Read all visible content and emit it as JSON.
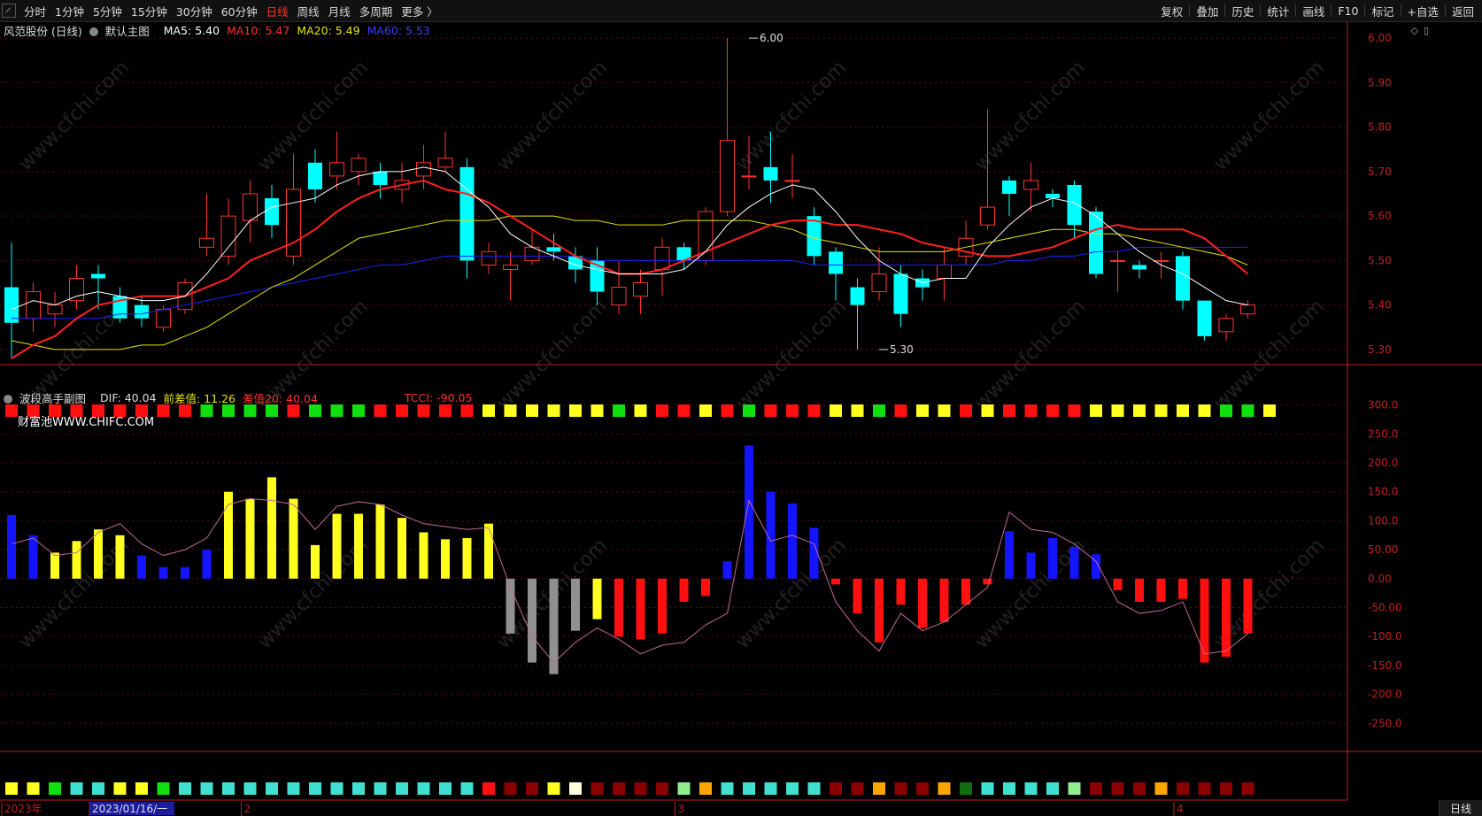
{
  "toolbar": {
    "periods": [
      {
        "label": "分时",
        "active": false
      },
      {
        "label": "1分钟",
        "active": false
      },
      {
        "label": "5分钟",
        "active": false
      },
      {
        "label": "15分钟",
        "active": false
      },
      {
        "label": "30分钟",
        "active": false
      },
      {
        "label": "60分钟",
        "active": false
      },
      {
        "label": "日线",
        "active": true
      },
      {
        "label": "周线",
        "active": false
      },
      {
        "label": "月线",
        "active": false
      },
      {
        "label": "多周期",
        "active": false
      },
      {
        "label": "更多 〉",
        "active": false
      }
    ],
    "right_items": [
      "复权",
      "叠加",
      "历史",
      "统计",
      "画线",
      "F10",
      "标记",
      "+自选",
      "返回"
    ]
  },
  "main_legend": {
    "stock": "风范股份 (日线)",
    "template": "默认主图",
    "ma5": "MA5: 5.40",
    "ma10": "MA10: 5.47",
    "ma20": "MA20: 5.49",
    "ma60": "MA60: 5.53"
  },
  "sub_legend": {
    "name": "波段高手副图",
    "dif": "DIF: 40.04",
    "prev_diff": "前差值: 11.26",
    "diff20": "差值20: 40.04",
    "tcci": "TCCI: -90.05"
  },
  "sub_watermark": "财富池WWW.CHIFC.COM",
  "watermark_text": "www.cfchi.com",
  "bottom_tag": "日线",
  "colors": {
    "up": "#ff3333",
    "down": "#00ffff",
    "ma5": "#ffffff",
    "ma10": "#ff2020",
    "ma20": "#e6e600",
    "ma60": "#2020ff",
    "axis": "#c02020",
    "grid": "#5a1010"
  },
  "chart_data": [
    {
      "type": "candlestick",
      "title": "风范股份 (日线)",
      "y_ticks": [
        "6.00",
        "5.90",
        "5.80",
        "5.70",
        "5.60",
        "5.50",
        "5.40",
        "5.30"
      ],
      "ylim": [
        5.27,
        6.03
      ],
      "annotations": [
        {
          "label": "6.00",
          "index": 34,
          "value": 6.0
        },
        {
          "label": "5.30",
          "index": 40,
          "value": 5.3
        }
      ],
      "x_labels": [
        {
          "label": "2023年",
          "index": 0
        },
        {
          "label": "2023/01/16/一",
          "index": 4
        },
        {
          "label": "2",
          "index": 11
        },
        {
          "label": "3",
          "index": 31
        },
        {
          "label": "4",
          "index": 54
        }
      ],
      "candles": [
        [
          5.44,
          5.36,
          5.54,
          5.28
        ],
        [
          5.37,
          5.43,
          5.45,
          5.34
        ],
        [
          5.38,
          5.4,
          5.43,
          5.35
        ],
        [
          5.41,
          5.46,
          5.49,
          5.39
        ],
        [
          5.47,
          5.46,
          5.49,
          5.39
        ],
        [
          5.42,
          5.37,
          5.44,
          5.36
        ],
        [
          5.4,
          5.37,
          5.42,
          5.35
        ],
        [
          5.35,
          5.39,
          5.4,
          5.34
        ],
        [
          5.39,
          5.45,
          5.46,
          5.38
        ],
        [
          5.53,
          5.55,
          5.65,
          5.51
        ],
        [
          5.51,
          5.6,
          5.64,
          5.49
        ],
        [
          5.59,
          5.65,
          5.68,
          5.54
        ],
        [
          5.64,
          5.58,
          5.67,
          5.55
        ],
        [
          5.51,
          5.66,
          5.74,
          5.49
        ],
        [
          5.72,
          5.66,
          5.75,
          5.63
        ],
        [
          5.69,
          5.72,
          5.79,
          5.66
        ],
        [
          5.7,
          5.73,
          5.74,
          5.67
        ],
        [
          5.7,
          5.67,
          5.72,
          5.64
        ],
        [
          5.66,
          5.68,
          5.72,
          5.63
        ],
        [
          5.69,
          5.72,
          5.76,
          5.66
        ],
        [
          5.71,
          5.73,
          5.79,
          5.7
        ],
        [
          5.71,
          5.5,
          5.73,
          5.46
        ],
        [
          5.49,
          5.52,
          5.54,
          5.47
        ],
        [
          5.48,
          5.49,
          5.52,
          5.41
        ],
        [
          5.5,
          5.53,
          5.57,
          5.49
        ],
        [
          5.53,
          5.52,
          5.56,
          5.5
        ],
        [
          5.51,
          5.48,
          5.53,
          5.45
        ],
        [
          5.5,
          5.43,
          5.53,
          5.4
        ],
        [
          5.4,
          5.44,
          5.5,
          5.38
        ],
        [
          5.42,
          5.45,
          5.48,
          5.38
        ],
        [
          5.48,
          5.53,
          5.55,
          5.42
        ],
        [
          5.53,
          5.5,
          5.54,
          5.48
        ],
        [
          5.5,
          5.61,
          5.62,
          5.49
        ],
        [
          5.61,
          5.77,
          6.0,
          5.6
        ],
        [
          5.69,
          5.69,
          5.78,
          5.66
        ],
        [
          5.71,
          5.68,
          5.79,
          5.63
        ],
        [
          5.68,
          5.68,
          5.74,
          5.64
        ],
        [
          5.6,
          5.51,
          5.62,
          5.49
        ],
        [
          5.52,
          5.47,
          5.53,
          5.41
        ],
        [
          5.44,
          5.4,
          5.46,
          5.3
        ],
        [
          5.43,
          5.47,
          5.53,
          5.41
        ],
        [
          5.47,
          5.38,
          5.49,
          5.35
        ],
        [
          5.46,
          5.44,
          5.48,
          5.41
        ],
        [
          5.46,
          5.49,
          5.53,
          5.41
        ],
        [
          5.51,
          5.55,
          5.59,
          5.49
        ],
        [
          5.58,
          5.62,
          5.84,
          5.57
        ],
        [
          5.68,
          5.65,
          5.69,
          5.6
        ],
        [
          5.66,
          5.68,
          5.72,
          5.61
        ],
        [
          5.65,
          5.64,
          5.66,
          5.62
        ],
        [
          5.67,
          5.58,
          5.68,
          5.55
        ],
        [
          5.61,
          5.47,
          5.62,
          5.46
        ],
        [
          5.5,
          5.5,
          5.52,
          5.43
        ],
        [
          5.49,
          5.48,
          5.5,
          5.46
        ],
        [
          5.5,
          5.5,
          5.52,
          5.46
        ],
        [
          5.51,
          5.41,
          5.52,
          5.39
        ],
        [
          5.41,
          5.33,
          5.41,
          5.32
        ],
        [
          5.34,
          5.37,
          5.38,
          5.32
        ],
        [
          5.38,
          5.4,
          5.41,
          5.37
        ]
      ],
      "ma5": [
        5.39,
        5.41,
        5.4,
        5.42,
        5.43,
        5.42,
        5.41,
        5.41,
        5.42,
        5.47,
        5.53,
        5.59,
        5.62,
        5.63,
        5.64,
        5.67,
        5.69,
        5.7,
        5.7,
        5.71,
        5.7,
        5.66,
        5.62,
        5.56,
        5.53,
        5.51,
        5.49,
        5.48,
        5.47,
        5.47,
        5.47,
        5.48,
        5.52,
        5.58,
        5.62,
        5.65,
        5.67,
        5.66,
        5.61,
        5.55,
        5.5,
        5.47,
        5.45,
        5.46,
        5.46,
        5.53,
        5.58,
        5.62,
        5.64,
        5.63,
        5.6,
        5.56,
        5.52,
        5.49,
        5.47,
        5.44,
        5.41,
        5.4
      ],
      "ma10": [
        5.28,
        5.31,
        5.33,
        5.37,
        5.4,
        5.41,
        5.42,
        5.42,
        5.42,
        5.44,
        5.46,
        5.5,
        5.52,
        5.54,
        5.57,
        5.61,
        5.64,
        5.66,
        5.67,
        5.68,
        5.66,
        5.65,
        5.63,
        5.6,
        5.57,
        5.54,
        5.51,
        5.49,
        5.47,
        5.47,
        5.48,
        5.5,
        5.52,
        5.54,
        5.56,
        5.58,
        5.59,
        5.59,
        5.58,
        5.58,
        5.57,
        5.56,
        5.54,
        5.53,
        5.52,
        5.51,
        5.51,
        5.52,
        5.53,
        5.55,
        5.57,
        5.58,
        5.57,
        5.57,
        5.57,
        5.55,
        5.51,
        5.47
      ],
      "ma20": [
        5.32,
        5.31,
        5.3,
        5.3,
        5.3,
        5.3,
        5.31,
        5.31,
        5.33,
        5.35,
        5.38,
        5.41,
        5.44,
        5.46,
        5.49,
        5.52,
        5.55,
        5.56,
        5.57,
        5.58,
        5.59,
        5.59,
        5.59,
        5.6,
        5.6,
        5.6,
        5.59,
        5.59,
        5.58,
        5.58,
        5.58,
        5.59,
        5.59,
        5.59,
        5.59,
        5.58,
        5.57,
        5.55,
        5.54,
        5.53,
        5.52,
        5.52,
        5.52,
        5.52,
        5.53,
        5.54,
        5.55,
        5.56,
        5.57,
        5.57,
        5.56,
        5.56,
        5.55,
        5.54,
        5.53,
        5.52,
        5.51,
        5.49
      ],
      "ma60": [
        5.37,
        5.37,
        5.37,
        5.37,
        5.37,
        5.38,
        5.38,
        5.39,
        5.4,
        5.41,
        5.42,
        5.43,
        5.44,
        5.45,
        5.46,
        5.47,
        5.48,
        5.49,
        5.49,
        5.5,
        5.51,
        5.51,
        5.51,
        5.51,
        5.51,
        5.51,
        5.51,
        5.5,
        5.5,
        5.5,
        5.5,
        5.5,
        5.5,
        5.5,
        5.5,
        5.5,
        5.5,
        5.49,
        5.49,
        5.49,
        5.49,
        5.49,
        5.49,
        5.49,
        5.49,
        5.49,
        5.5,
        5.5,
        5.51,
        5.51,
        5.52,
        5.52,
        5.53,
        5.53,
        5.53,
        5.53,
        5.53,
        5.53
      ]
    },
    {
      "type": "bar",
      "title": "波段高手副图",
      "y_ticks": [
        "300.0",
        "250.0",
        "200.0",
        "150.0",
        "100.0",
        "50.00",
        "0.00",
        "-50.00",
        "-100.0",
        "-150.0",
        "-200.0",
        "-250.0"
      ],
      "ylim": [
        -300,
        330
      ],
      "bars": [
        110,
        75,
        45,
        65,
        85,
        75,
        40,
        20,
        20,
        50,
        150,
        138,
        175,
        138,
        58,
        112,
        112,
        128,
        105,
        80,
        68,
        70,
        95,
        -95,
        -145,
        -165,
        -90,
        -70,
        -100,
        -105,
        -95,
        -40,
        -30,
        30,
        230,
        150,
        130,
        88,
        -10,
        -60,
        -110,
        -45,
        -85,
        -75,
        -45,
        -10,
        82,
        45,
        70,
        55,
        42,
        -20,
        -40,
        -40,
        -35,
        -145,
        -135,
        -95
      ],
      "bar_colors": [
        "blue",
        "blue",
        "yellow",
        "yellow",
        "yellow",
        "yellow",
        "blue",
        "blue",
        "blue",
        "blue",
        "yellow",
        "yellow",
        "yellow",
        "yellow",
        "yellow",
        "yellow",
        "yellow",
        "yellow",
        "yellow",
        "yellow",
        "yellow",
        "yellow",
        "yellow",
        "gray",
        "gray",
        "gray",
        "gray",
        "yellow",
        "red",
        "red",
        "red",
        "red",
        "red",
        "blue",
        "blue",
        "blue",
        "blue",
        "blue",
        "red",
        "red",
        "red",
        "red",
        "red",
        "red",
        "red",
        "red",
        "blue",
        "blue",
        "blue",
        "blue",
        "blue",
        "red",
        "red",
        "red",
        "red",
        "red",
        "red",
        "red"
      ],
      "line": [
        60,
        70,
        40,
        45,
        80,
        95,
        60,
        40,
        50,
        70,
        128,
        138,
        135,
        128,
        85,
        125,
        133,
        128,
        110,
        95,
        90,
        85,
        88,
        -15,
        -100,
        -145,
        -110,
        -85,
        -105,
        -130,
        -115,
        -110,
        -80,
        -60,
        135,
        65,
        75,
        60,
        -40,
        -90,
        -125,
        -60,
        -90,
        -75,
        -45,
        -15,
        115,
        85,
        80,
        60,
        30,
        -40,
        -60,
        -55,
        -40,
        -130,
        -125,
        -95
      ],
      "top_markers": [
        "red",
        "red",
        "red",
        "red",
        "red",
        "red",
        "red",
        "red",
        "red",
        "green",
        "green",
        "green",
        "green",
        "red",
        "green",
        "green",
        "green",
        "red",
        "red",
        "red",
        "red",
        "red",
        "yellow",
        "yellow",
        "yellow",
        "yellow",
        "yellow",
        "yellow",
        "green",
        "yellow",
        "red",
        "red",
        "yellow",
        "red",
        "green",
        "red",
        "red",
        "red",
        "yellow",
        "yellow",
        "green",
        "red",
        "yellow",
        "yellow",
        "red",
        "yellow",
        "red",
        "red",
        "red",
        "red",
        "yellow",
        "yellow",
        "yellow",
        "yellow",
        "yellow",
        "yellow",
        "green",
        "green",
        "yellow"
      ],
      "bottom_markers": [
        "yellow",
        "yellow",
        "green",
        "cyan",
        "cyan",
        "yellow",
        "yellow",
        "green",
        "cyan",
        "cyan",
        "cyan",
        "cyan",
        "cyan",
        "cyan",
        "cyan",
        "cyan",
        "cyan",
        "cyan",
        "cyan",
        "cyan",
        "cyan",
        "cyan",
        "red",
        "darkred",
        "darkred",
        "yellow",
        "white",
        "darkred",
        "darkred",
        "darkred",
        "darkred",
        "lightgreen",
        "orange",
        "cyan",
        "cyan",
        "cyan",
        "cyan",
        "cyan",
        "darkred",
        "darkred",
        "orange",
        "darkred",
        "darkred",
        "orange",
        "darkgreen",
        "cyan",
        "cyan",
        "cyan",
        "cyan",
        "lightgreen",
        "darkred",
        "darkred",
        "darkred",
        "orange",
        "darkred",
        "darkred",
        "darkred",
        "darkred"
      ]
    }
  ]
}
